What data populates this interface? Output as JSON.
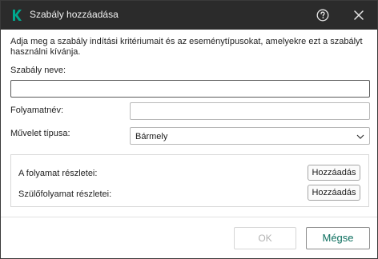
{
  "window": {
    "title": "Szabály hozzáadása",
    "logo_icon": "kaspersky-k-icon",
    "help_icon": "help-circle-icon",
    "close_icon": "close-icon"
  },
  "description": "Adja meg a szabály indítási kritériumait és az eseménytípusokat, amelyekre ezt a szabályt használni kívánja.",
  "form": {
    "rule_name_label": "Szabály neve:",
    "rule_name_value": "",
    "process_name_label": "Folyamatnév:",
    "process_name_value": "",
    "operation_type_label": "Művelet típusa:",
    "operation_type_value": "Bármely"
  },
  "details": {
    "process_details_label": "A folyamat részletei:",
    "process_details_button": "Hozzáadás",
    "parent_process_label": "Szülőfolyamat részletei:",
    "parent_process_button": "Hozzáadás"
  },
  "footer": {
    "ok_label": "OK",
    "cancel_label": "Mégse"
  },
  "colors": {
    "titlebar_bg": "#2b2b2b",
    "brand_green": "#00a88e",
    "cancel_text": "#0b6e5e",
    "disabled_text": "#b3b3b3"
  }
}
